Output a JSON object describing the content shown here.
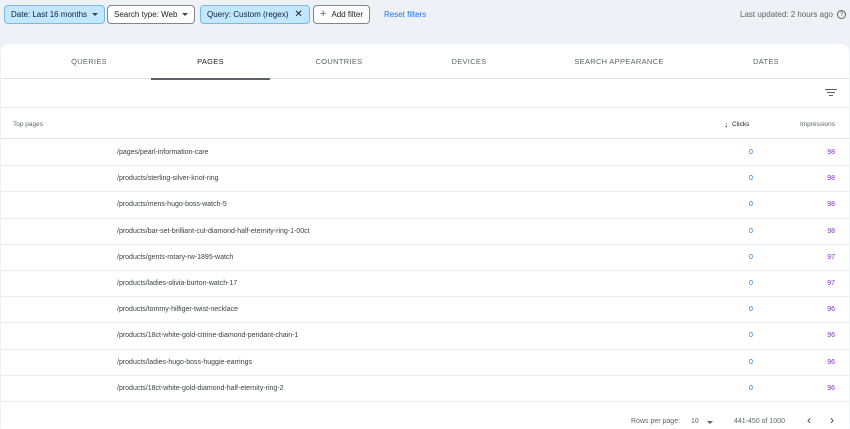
{
  "filters": {
    "date_chip": "Date: Last 16 months",
    "search_type_chip": "Search type: Web",
    "query_chip": "Query: Custom (regex)",
    "add_filter": "Add filter",
    "reset": "Reset filters",
    "last_updated": "Last updated: 2 hours ago",
    "colors": {
      "active_chip": "#c2e7ff",
      "link": "#1a73e8"
    }
  },
  "tabs": [
    "QUERIES",
    "PAGES",
    "COUNTRIES",
    "DEVICES",
    "SEARCH APPEARANCE",
    "DATES"
  ],
  "selected_tab": "PAGES",
  "table": {
    "header": {
      "pages": "Top pages",
      "clicks": "Clicks",
      "impressions": "Impressions"
    },
    "rows": [
      {
        "url": "/pages/pearl-information-care",
        "clicks": "0",
        "impressions": "98"
      },
      {
        "url": "/products/sterling-silver-knot-ring",
        "clicks": "0",
        "impressions": "98"
      },
      {
        "url": "/products/mens-hugo-boss-watch-5",
        "clicks": "0",
        "impressions": "98"
      },
      {
        "url": "/products/bar-set-brilliant-cut-diamond-half-eternity-ring-1-00ct",
        "clicks": "0",
        "impressions": "98"
      },
      {
        "url": "/products/gents-rotary-rw-1895-watch",
        "clicks": "0",
        "impressions": "97"
      },
      {
        "url": "/products/ladies-olivia-burton-watch-17",
        "clicks": "0",
        "impressions": "97"
      },
      {
        "url": "/products/tommy-hilfiger-twist-necklace",
        "clicks": "0",
        "impressions": "96"
      },
      {
        "url": "/products/18ct-white-gold-citrine-diamond-pendant-chain-1",
        "clicks": "0",
        "impressions": "96"
      },
      {
        "url": "/products/ladies-hugo-boss-huggie-earrings",
        "clicks": "0",
        "impressions": "96"
      },
      {
        "url": "/products/18ct-white-gold-diamond-half-eternity-ring-2",
        "clicks": "0",
        "impressions": "96"
      }
    ],
    "colors": {
      "clicks": "#1a73e8",
      "impressions": "#8430ce"
    }
  },
  "pagination": {
    "rows_per_page_label": "Rows per page:",
    "rows_per_page": "10",
    "range": "441-450 of 1000",
    "prev_icon": "chevron-left-icon",
    "next_icon": "chevron-right-icon"
  }
}
